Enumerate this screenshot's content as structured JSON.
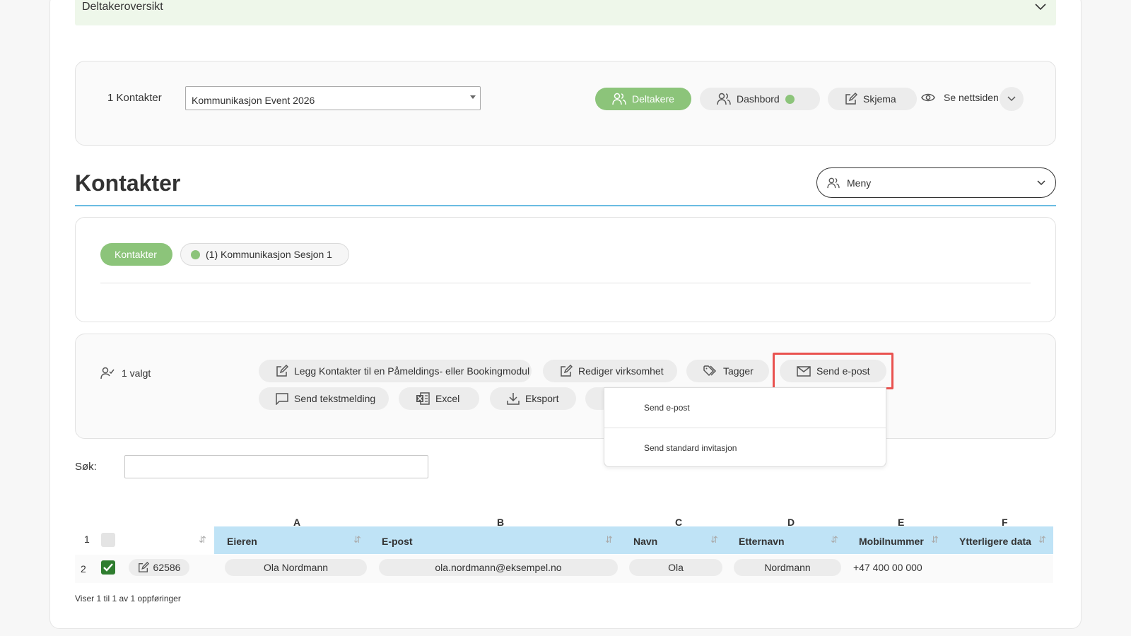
{
  "accordion": {
    "title": "Deltakeroversikt"
  },
  "event_bar": {
    "contacts_count": "1 Kontakter",
    "event_select": "Kommunikasjon Event 2026",
    "buttons": {
      "deltakere": "Deltakere",
      "dashbord": "Dashbord",
      "skjema": "Skjema",
      "se_nettsiden": "Se nettsiden"
    }
  },
  "page": {
    "title": "Kontakter",
    "menu_label": "Meny"
  },
  "tabs": {
    "active": "Kontakter",
    "session": "(1) Kommunikasjon Sesjon 1"
  },
  "actions": {
    "selected": "1 valgt",
    "add_to_module": "Legg Kontakter til en Påmeldings- eller Bookingmodul",
    "edit_company": "Rediger virksomhet",
    "tags": "Tagger",
    "send_email": "Send e-post",
    "send_sms": "Send tekstmelding",
    "excel": "Excel",
    "export": "Eksport"
  },
  "email_dropdown": {
    "items": [
      "Send e-post",
      "Send standard invitasjon"
    ]
  },
  "search": {
    "label": "Søk:",
    "value": ""
  },
  "table": {
    "column_letters": [
      "A",
      "B",
      "C",
      "D",
      "E",
      "F"
    ],
    "row_numbers": [
      "1",
      "2"
    ],
    "headers": [
      "Eieren",
      "E-post",
      "Navn",
      "Etternavn",
      "Mobilnummer",
      "Ytterligere data"
    ],
    "rows": [
      {
        "id": "62586",
        "checked": true,
        "owner": "Ola Nordmann",
        "email": "ola.nordmann@eksempel.no",
        "first_name": "Ola",
        "last_name": "Nordmann",
        "mobile": "+47 400 00 000",
        "extra": ""
      }
    ],
    "footer": "Viser 1 til 1 av 1 oppføringer"
  },
  "colors": {
    "accent_green": "#8cc47a",
    "header_blue": "#bfe3f6",
    "title_rule": "#6bbce2",
    "highlight_red": "#e9524f"
  }
}
